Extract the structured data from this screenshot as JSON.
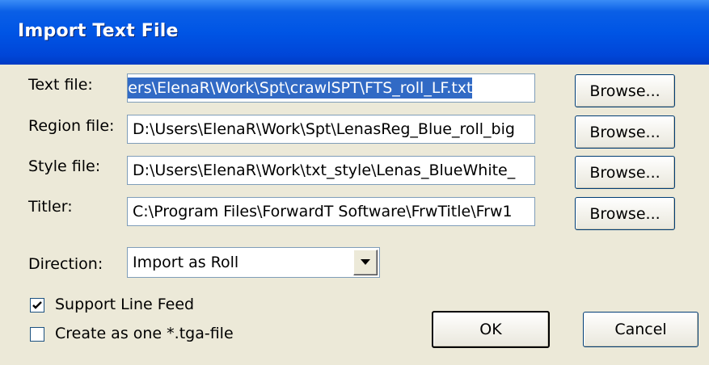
{
  "window": {
    "title": "Import Text File"
  },
  "fields": [
    {
      "label": "Text file:",
      "value": "\\Users\\ElenaR\\Work\\Spt\\crawlSPT\\FTS_roll_LF.txt",
      "browse": "Browse..."
    },
    {
      "label": "Region file:",
      "value": "D:\\Users\\ElenaR\\Work\\Spt\\LenasReg_Blue_roll_big",
      "browse": "Browse..."
    },
    {
      "label": "Style file:",
      "value": "D:\\Users\\ElenaR\\Work\\txt_style\\Lenas_BlueWhite_",
      "browse": "Browse..."
    },
    {
      "label": "Titler:",
      "value": "C:\\Program Files\\ForwardT Software\\FrwTitle\\Frw1",
      "browse": "Browse..."
    }
  ],
  "direction": {
    "label": "Direction:",
    "value": "Import as Roll"
  },
  "options": {
    "line_feed": {
      "label": "Support Line Feed",
      "checked": true
    },
    "one_tga": {
      "label": "Create as one *.tga-file",
      "checked": false
    }
  },
  "buttons": {
    "ok": "OK",
    "cancel": "Cancel"
  },
  "colors": {
    "title_bar": "#0055e5",
    "dialog_bg": "#ece9d8",
    "selection": "#316ac5"
  }
}
